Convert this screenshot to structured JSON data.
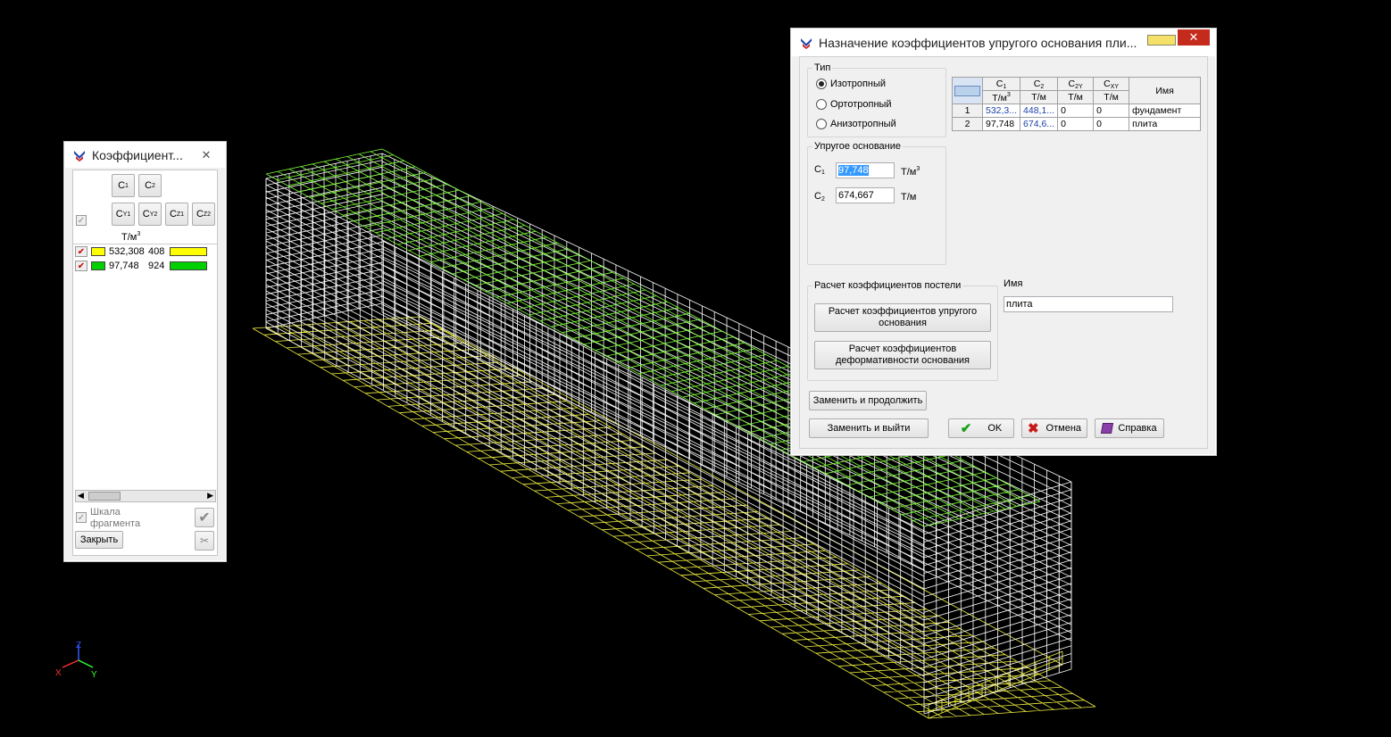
{
  "colors": {
    "green_mesh": "#7cfc3a",
    "yellow_mesh": "#f0f040",
    "white_mesh": "#ffffff",
    "yellow_swatch": "#ffff00",
    "green_swatch": "#00d000"
  },
  "axis": {
    "z": "Z",
    "x": "X",
    "y": "Y"
  },
  "left_panel": {
    "title": "Коэффициент...",
    "close": "✕",
    "tabs_row1": [
      "C1",
      "C2"
    ],
    "tabs_row2": [
      "CY1",
      "CY2",
      "CZ1",
      "CZ2"
    ],
    "unit_header": "Т/м",
    "unit_sup": "3",
    "rows": [
      {
        "value": "532,308",
        "value2": "408",
        "color_name": "yellow"
      },
      {
        "value": "97,748",
        "value2": "924",
        "color_name": "green"
      }
    ],
    "scale_label_1": "Шкала",
    "scale_label_2": "фрагмента",
    "close_button": "Закрыть"
  },
  "dialog": {
    "title": "Назначение коэффициентов упругого основания пли...",
    "close": "✕",
    "type_group": "Тип",
    "radio": [
      "Изотропный",
      "Ортотропный",
      "Анизотропный"
    ],
    "selected_radio": "Изотропный",
    "elastic_group": "Упругое основание",
    "c1_label": "C",
    "c1_sub": "1",
    "c1_value": "97,748",
    "c1_unit": "Т/м",
    "c1_unit_sup": "3",
    "c2_label": "C",
    "c2_sub": "2",
    "c2_value": "674,667",
    "c2_unit": "Т/м",
    "table": {
      "headers": [
        {
          "main": "C",
          "sub": "1",
          "unit": "Т/м",
          "unit_sup": "3"
        },
        {
          "main": "C",
          "sub": "2",
          "unit": "Т/м",
          "unit_sup": ""
        },
        {
          "main": "C",
          "sub": "2Y",
          "unit": "Т/м",
          "unit_sup": ""
        },
        {
          "main": "C",
          "sub": "XY",
          "unit": "Т/м",
          "unit_sup": ""
        }
      ],
      "name_header": "Имя",
      "rows": [
        {
          "n": "1",
          "c1": "532,3...",
          "c2": "448,1...",
          "c2y": "0",
          "cxy": "0",
          "name": "фундамент"
        },
        {
          "n": "2",
          "c1": "97,748",
          "c2": "674,6...",
          "c2y": "0",
          "cxy": "0",
          "name": "плита"
        }
      ]
    },
    "calc_group": "Расчет коэффициентов постели",
    "calc_btn1": "Расчет коэффициентов упругого основания",
    "calc_btn2": "Расчет коэффициентов деформативности основания",
    "name_label": "Имя",
    "name_value": "плита",
    "replace_continue": "Заменить и продолжить",
    "replace_exit": "Заменить и выйти",
    "ok": "OK",
    "cancel": "Отмена",
    "help": "Справка"
  }
}
